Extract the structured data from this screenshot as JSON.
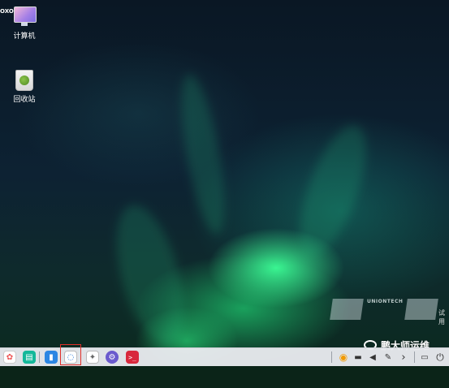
{
  "desktop": {
    "corner_text": "OXO",
    "icons": [
      {
        "label": "计算机",
        "icon": "computer-icon"
      },
      {
        "label": "回收站",
        "icon": "trash-icon"
      }
    ],
    "watermark": {
      "brand": "UNIONTECH",
      "trial_label": "试用"
    },
    "overlay_caption": "鹏大师运维"
  },
  "taskbar": {
    "apps": [
      {
        "name": "launcher",
        "icon": "launcher-icon",
        "glyph": "✿",
        "color": "#ffffff"
      },
      {
        "name": "multitasking",
        "icon": "multitask-view-icon",
        "glyph": "▤",
        "color": "#14b89a"
      },
      {
        "name": "file-manager",
        "icon": "folder-icon",
        "glyph": "▮",
        "color": "#2b86e3"
      },
      {
        "name": "browser",
        "icon": "browser-icon",
        "glyph": "◌",
        "color": "#ffffff"
      },
      {
        "name": "app-store",
        "icon": "app-store-icon",
        "glyph": "✦",
        "color": "#ffffff"
      },
      {
        "name": "settings",
        "icon": "settings-icon",
        "glyph": "⚙",
        "color": "#6a5acd"
      },
      {
        "name": "terminal",
        "icon": "terminal-icon",
        "glyph": ">_",
        "color": "#d8283c"
      }
    ],
    "tray": [
      {
        "name": "power-saver",
        "icon": "power-saver-icon",
        "glyph": "◉"
      },
      {
        "name": "keyboard",
        "icon": "keyboard-icon",
        "glyph": "▬"
      },
      {
        "name": "volume",
        "icon": "volume-icon",
        "glyph": "◀"
      },
      {
        "name": "pen",
        "icon": "pen-icon",
        "glyph": "✎"
      },
      {
        "name": "expand",
        "icon": "chevron-right-icon",
        "glyph": "›"
      },
      {
        "name": "show-desktop",
        "icon": "show-desktop-icon",
        "glyph": "▭"
      },
      {
        "name": "shutdown",
        "icon": "power-icon",
        "glyph": "⏻"
      }
    ],
    "highlight_color": "#e0302a"
  }
}
